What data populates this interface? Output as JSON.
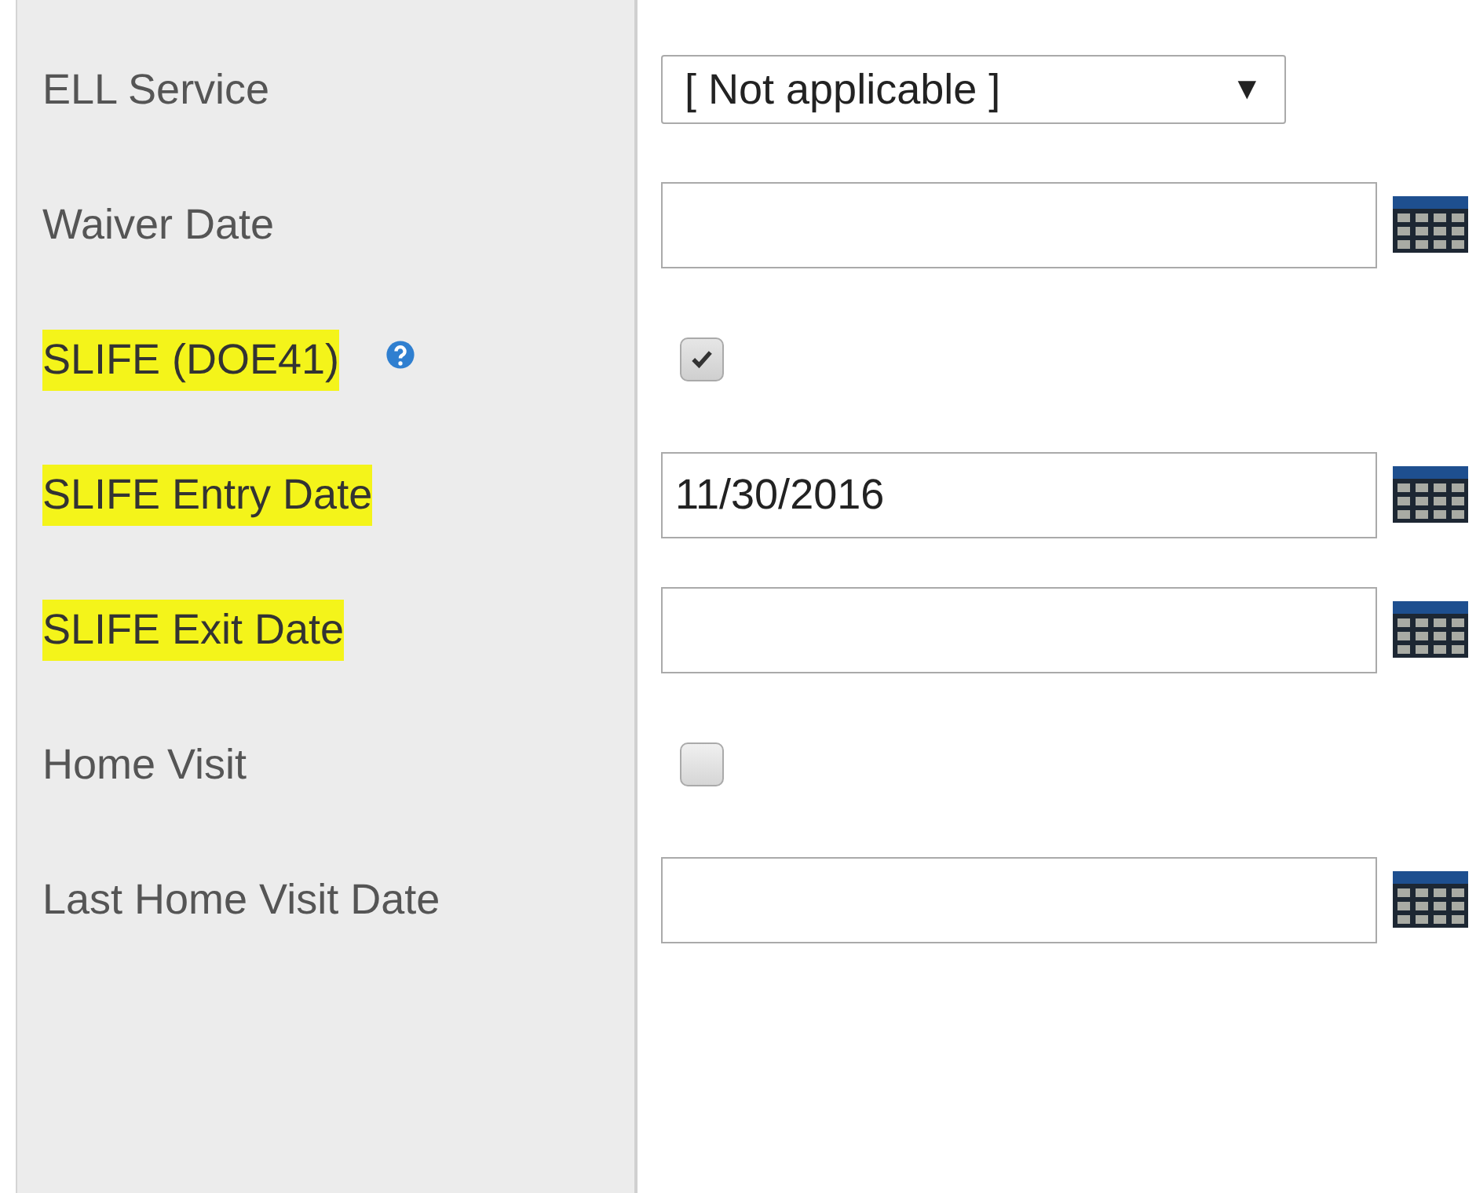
{
  "fields": [
    {
      "label": "ELL Service",
      "highlighted": false,
      "kind": "select",
      "value": "[ Not applicable ]",
      "caret": "▼"
    },
    {
      "label": "Waiver Date",
      "highlighted": false,
      "kind": "date"
    },
    {
      "label": "SLIFE (DOE41)",
      "highlighted": true,
      "help": true,
      "kind": "checkbox",
      "checked": true
    },
    {
      "label": "SLIFE Entry Date",
      "highlighted": true,
      "kind": "date",
      "value": "11/30/2016"
    },
    {
      "label": "SLIFE Exit Date",
      "highlighted": true,
      "kind": "date"
    },
    {
      "label": "Home Visit",
      "highlighted": false,
      "kind": "checkbox",
      "checked": false
    },
    {
      "label": "Last Home Visit Date",
      "highlighted": false,
      "kind": "date"
    }
  ]
}
